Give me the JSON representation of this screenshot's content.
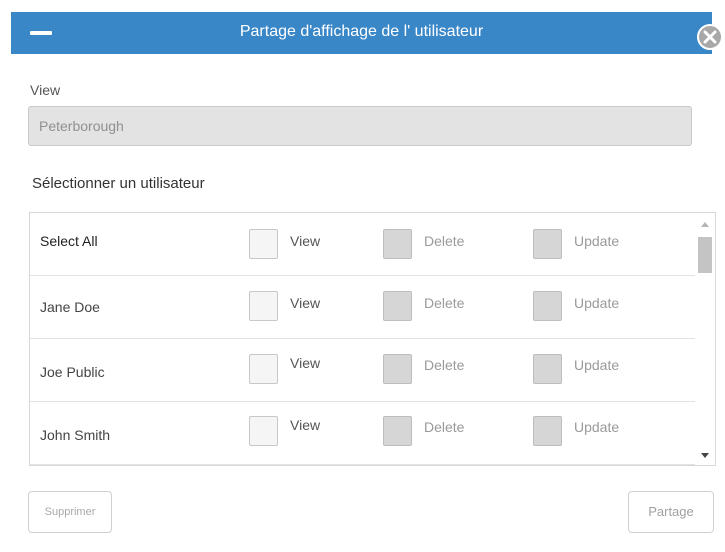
{
  "dialog": {
    "title": "Partage d'affichage de l' utilisateur",
    "minimize_icon": "minus-icon",
    "close_icon": "close-circle-icon",
    "title_bar_color": "#3a87c8"
  },
  "view": {
    "label": "View",
    "value": "Peterborough"
  },
  "user_select": {
    "label": "Sélectionner un utilisateur",
    "rows": [
      {
        "name": "Select All",
        "view_label": "View",
        "delete_label": "Delete",
        "update_label": "Update"
      },
      {
        "name": "Jane Doe",
        "view_label": "View",
        "delete_label": "Delete",
        "update_label": "Update"
      },
      {
        "name": "Joe Public",
        "view_label": "View",
        "delete_label": "Delete",
        "update_label": "Update"
      },
      {
        "name": "John Smith",
        "view_label": "View",
        "delete_label": "Delete",
        "update_label": "Update"
      }
    ]
  },
  "buttons": {
    "delete_label": "Supprimer",
    "share_label": "Partage"
  }
}
